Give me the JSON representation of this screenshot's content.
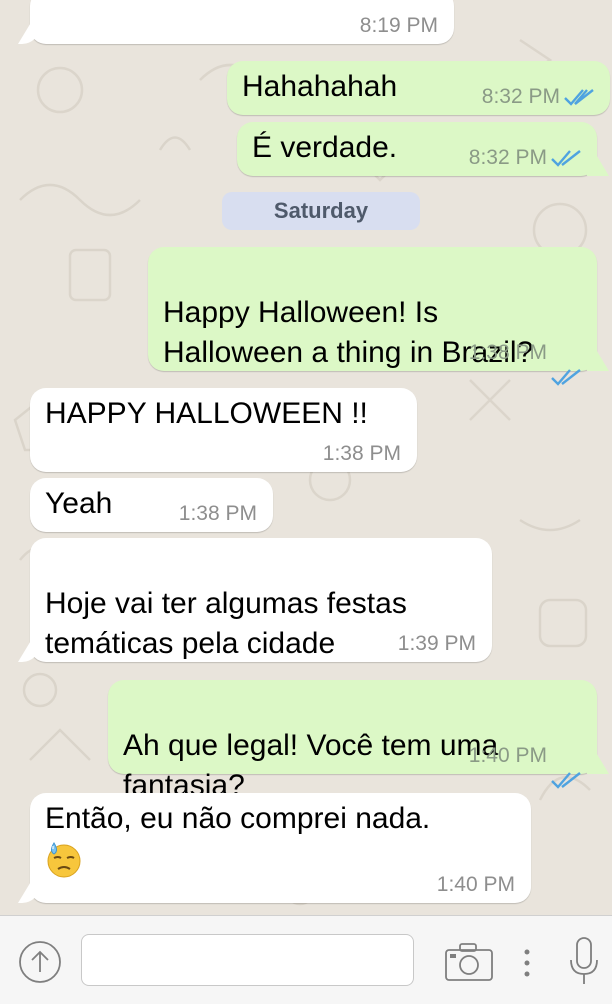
{
  "chat": {
    "messages": [
      {
        "text": "",
        "time": "8:19 PM"
      },
      {
        "text": "Hahahahah",
        "time": "8:32 PM"
      },
      {
        "text": "É verdade.",
        "time": "8:32 PM"
      },
      {
        "text": "Happy Halloween! Is\nHalloween a thing in Brazil?",
        "time": "1:38 PM"
      },
      {
        "text": "HAPPY HALLOWEEN !!",
        "time": "1:38 PM"
      },
      {
        "text": "Yeah",
        "time": "1:38 PM"
      },
      {
        "text": "Hoje vai ter algumas festas\ntemáticas pela cidade",
        "time": "1:39 PM"
      },
      {
        "text": "Ah que legal! Você tem uma\nfantasia?",
        "time": "1:40 PM"
      },
      {
        "text": "Então, eu não comprei nada.",
        "time": "1:40 PM",
        "emoji": "downcast-face-with-sweat"
      }
    ],
    "date_separator": "Saturday"
  },
  "input_bar": {
    "message_value": "",
    "icons": [
      "upload-arrow-icon",
      "camera-icon",
      "more-dots-icon",
      "microphone-icon"
    ]
  },
  "colors": {
    "incoming_bubble": "#ffffff",
    "outgoing_bubble": "#dcf8c6",
    "read_ticks": "#4fa3e0",
    "date_pill": "#d8def0"
  }
}
